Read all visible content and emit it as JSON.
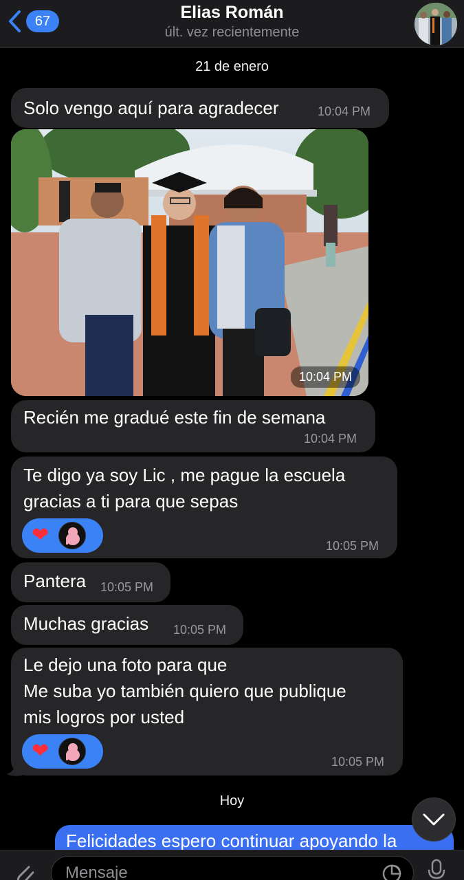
{
  "header": {
    "back_count": "67",
    "contact_name": "Elias Román",
    "status": "últ. vez recientemente"
  },
  "date_separators": {
    "first": "21 de enero",
    "second": "Hoy"
  },
  "messages": [
    {
      "text": "Solo vengo aquí para agradecer",
      "time": "10:04 PM"
    },
    {
      "photo_time": "10:04 PM"
    },
    {
      "text": "Recién me gradué este fin de semana",
      "time": "10:04 PM"
    },
    {
      "lines": [
        "Te digo ya soy Lic , me pague la escuela",
        "gracias a ti para que sepas"
      ],
      "time": "10:05 PM",
      "reactions": [
        "heart-icon",
        "avatar"
      ]
    },
    {
      "text": "Pantera",
      "time": "10:05 PM"
    },
    {
      "text": "Muchas gracias",
      "time": "10:05 PM"
    },
    {
      "lines": [
        "Le dejo una foto para que",
        "Me suba yo también quiero que publique",
        "mis logros por usted"
      ],
      "time": "10:05 PM",
      "reactions": [
        "heart-icon",
        "avatar"
      ]
    }
  ],
  "outgoing": {
    "text": "Felicidades espero continuar apoyando la"
  },
  "composer": {
    "placeholder": "Mensaje"
  },
  "colors": {
    "accent": "#3a82f6",
    "bubble_in": "#262628",
    "bubble_out": "#3a6ff2",
    "heart": "#ff2d3a"
  }
}
